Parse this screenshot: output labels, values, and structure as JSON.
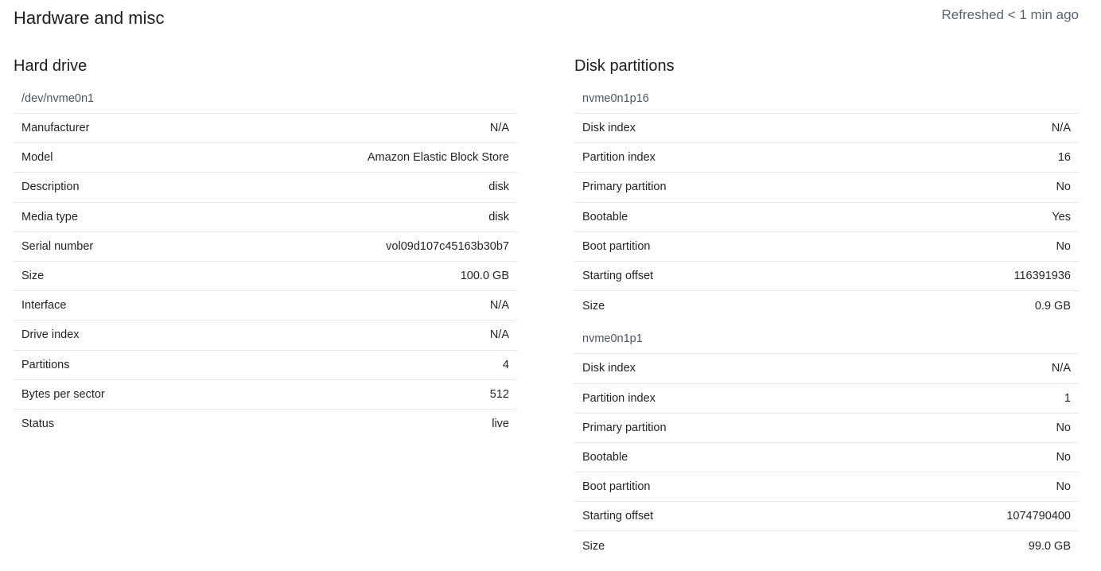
{
  "header": {
    "title": "Hardware and misc",
    "refreshed": "Refreshed < 1 min ago"
  },
  "hard_drive": {
    "title": "Hard drive",
    "device": "/dev/nvme0n1",
    "rows": [
      {
        "label": "Manufacturer",
        "value": "N/A"
      },
      {
        "label": "Model",
        "value": "Amazon Elastic Block Store"
      },
      {
        "label": "Description",
        "value": "disk"
      },
      {
        "label": "Media type",
        "value": "disk"
      },
      {
        "label": "Serial number",
        "value": "vol09d107c45163b30b7"
      },
      {
        "label": "Size",
        "value": "100.0 GB"
      },
      {
        "label": "Interface",
        "value": "N/A"
      },
      {
        "label": "Drive index",
        "value": "N/A"
      },
      {
        "label": "Partitions",
        "value": "4"
      },
      {
        "label": "Bytes per sector",
        "value": "512"
      },
      {
        "label": "Status",
        "value": "live"
      }
    ]
  },
  "disk_partitions": {
    "title": "Disk partitions",
    "partitions": [
      {
        "name": "nvme0n1p16",
        "rows": [
          {
            "label": "Disk index",
            "value": "N/A"
          },
          {
            "label": "Partition index",
            "value": "16"
          },
          {
            "label": "Primary partition",
            "value": "No"
          },
          {
            "label": "Bootable",
            "value": "Yes"
          },
          {
            "label": "Boot partition",
            "value": "No"
          },
          {
            "label": "Starting offset",
            "value": "116391936"
          },
          {
            "label": "Size",
            "value": "0.9 GB"
          }
        ]
      },
      {
        "name": "nvme0n1p1",
        "rows": [
          {
            "label": "Disk index",
            "value": "N/A"
          },
          {
            "label": "Partition index",
            "value": "1"
          },
          {
            "label": "Primary partition",
            "value": "No"
          },
          {
            "label": "Bootable",
            "value": "No"
          },
          {
            "label": "Boot partition",
            "value": "No"
          },
          {
            "label": "Starting offset",
            "value": "1074790400"
          },
          {
            "label": "Size",
            "value": "99.0 GB"
          }
        ]
      }
    ]
  }
}
